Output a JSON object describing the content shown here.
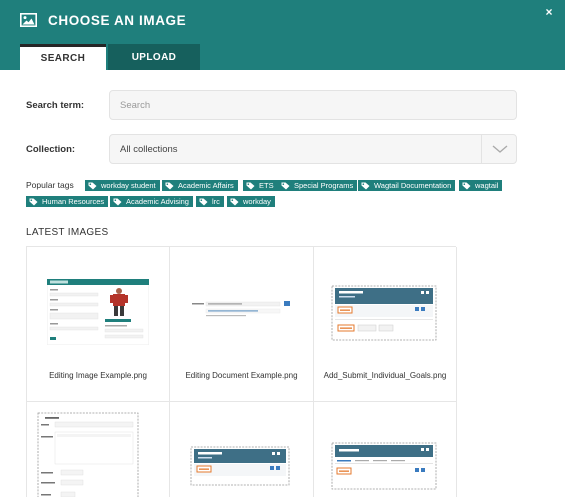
{
  "header": {
    "title": "CHOOSE AN IMAGE",
    "close": "×",
    "icon": "image-icon",
    "background": "#1f7f7c"
  },
  "tabs": [
    {
      "label": "SEARCH",
      "active": true
    },
    {
      "label": "UPLOAD",
      "active": false
    }
  ],
  "search": {
    "label": "Search term:",
    "placeholder": "Search",
    "value": ""
  },
  "collection": {
    "label": "Collection:",
    "selected": "All collections"
  },
  "popular_tags": {
    "label": "Popular tags",
    "tags": [
      "workday student",
      "Academic Affairs",
      "ETS",
      "Special Programs",
      "Wagtail Documentation",
      "wagtail",
      "Human Resources",
      "Academic Advising",
      "lrc",
      "workday"
    ]
  },
  "latest": {
    "title": "LATEST IMAGES",
    "images": [
      {
        "caption": "Editing Image Example.png"
      },
      {
        "caption": "Editing Document Example.png"
      },
      {
        "caption": "Add_Submit_Individual_Goals.png"
      },
      {
        "caption": ""
      },
      {
        "caption": ""
      },
      {
        "caption": ""
      }
    ]
  }
}
